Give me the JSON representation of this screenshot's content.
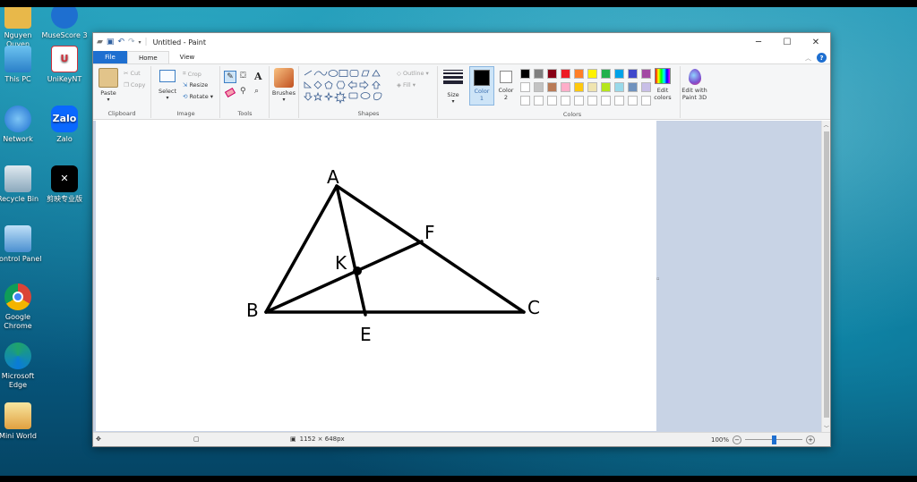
{
  "desktop": {
    "icons": [
      {
        "label": "Nguyen\nQuyen",
        "icon": "user-folder-icon",
        "color": "#e8b84a"
      },
      {
        "label": "MuseScore 3",
        "icon": "musescore-icon",
        "color": "#1e6fd0"
      },
      {
        "label": "This PC",
        "icon": "computer-icon",
        "color": "#4aa3e0"
      },
      {
        "label": "UniKeyNT",
        "icon": "unikey-icon",
        "color": "#d0303a"
      },
      {
        "label": "Network",
        "icon": "network-icon",
        "color": "#3b8ad8"
      },
      {
        "label": "Zalo",
        "icon": "zalo-icon",
        "color": "#0a68ff"
      },
      {
        "label": "Recycle Bin",
        "icon": "recycle-bin-icon",
        "color": "#9fb8c8"
      },
      {
        "label": "剪映专业版",
        "icon": "capcut-icon",
        "color": "#000000"
      },
      {
        "label": "Control Panel",
        "icon": "control-panel-icon",
        "color": "#5aa0d8"
      },
      {
        "label": "Google\nChrome",
        "icon": "chrome-icon",
        "color": "#db4437"
      },
      {
        "label": "Microsoft\nEdge",
        "icon": "edge-icon",
        "color": "#1fa36b"
      },
      {
        "label": "Mini World",
        "icon": "mini-world-icon",
        "color": "#f0c040"
      }
    ]
  },
  "window": {
    "title": "Untitled - Paint",
    "controls": {
      "minimize": "─",
      "maximize": "☐",
      "close": "✕"
    }
  },
  "tabs": {
    "file": "File",
    "home": "Home",
    "view": "View"
  },
  "ribbon": {
    "clipboard": {
      "paste": "Paste",
      "cut": "Cut",
      "copy": "Copy",
      "label": "Clipboard"
    },
    "image": {
      "select": "Select",
      "crop": "Crop",
      "resize": "Resize",
      "rotate": "Rotate",
      "label": "Image"
    },
    "tools": {
      "label": "Tools"
    },
    "brushes": {
      "label": "Brushes"
    },
    "shapes": {
      "outline": "Outline",
      "fill": "Fill",
      "label": "Shapes"
    },
    "size": {
      "label": "Size"
    },
    "color1": {
      "label": "Color\n1",
      "value": "#000000"
    },
    "color2": {
      "label": "Color\n2",
      "value": "#ffffff"
    },
    "colors_label": "Colors",
    "edit_colors": "Edit\ncolors",
    "edit_paint3d": "Edit with\nPaint 3D",
    "palette_row1": [
      "#000000",
      "#7f7f7f",
      "#880015",
      "#ed1c24",
      "#ff7f27",
      "#fff200",
      "#22b14c",
      "#00a2e8",
      "#3f48cc",
      "#a349a4"
    ],
    "palette_row2": [
      "#ffffff",
      "#c3c3c3",
      "#b97a57",
      "#ffaec9",
      "#ffc90e",
      "#efe4b0",
      "#b5e61d",
      "#99d9ea",
      "#7092be",
      "#c8bfe7"
    ]
  },
  "drawing": {
    "labels": {
      "A": "A",
      "B": "B",
      "C": "C",
      "E": "E",
      "F": "F",
      "K": "K"
    }
  },
  "status": {
    "dimensions": "1152 × 648px",
    "zoom": "100%",
    "zoom_fraction": 0.5
  }
}
